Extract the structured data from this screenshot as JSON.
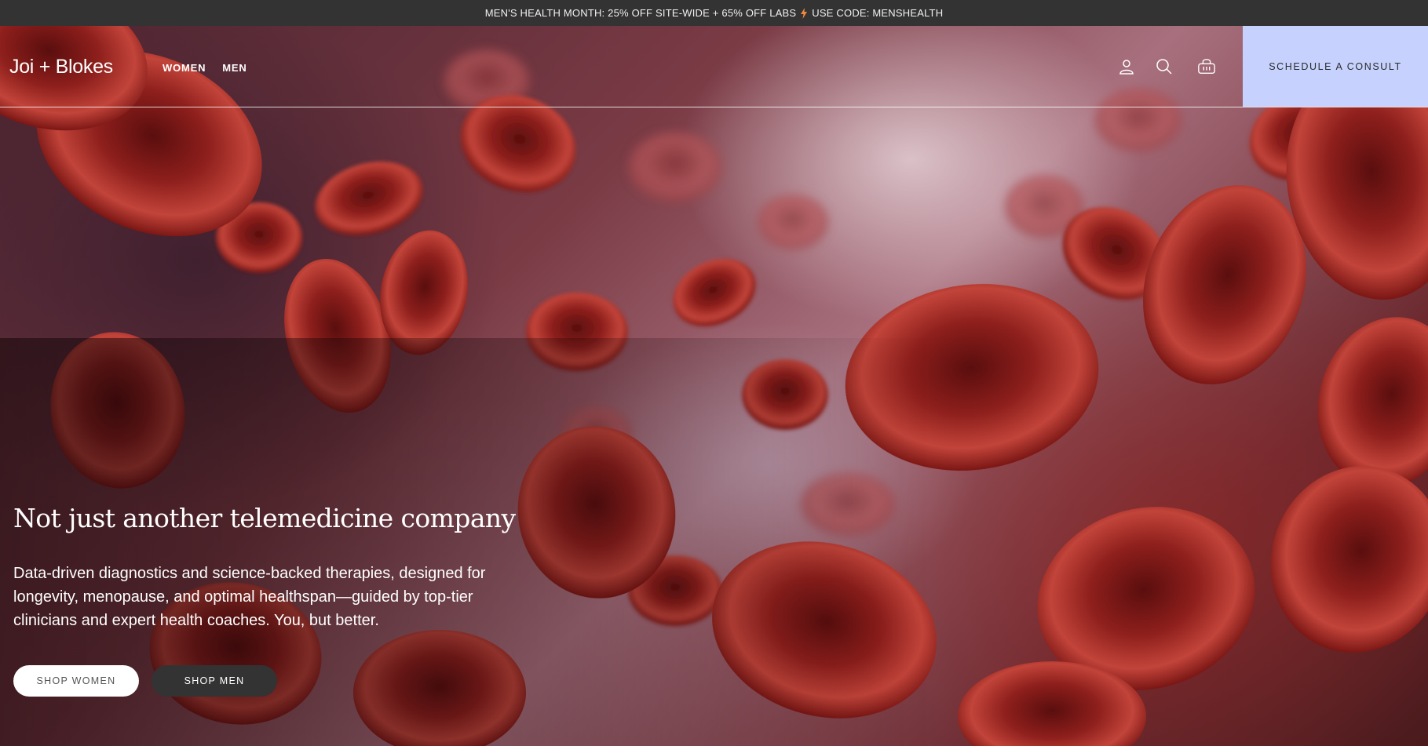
{
  "announcement": {
    "text_before": "MEN'S HEALTH MONTH: 25% OFF SITE-WIDE + 65% OFF LABS",
    "icon": "lightning-bolt-icon",
    "text_after": "USE CODE: MENSHEALTH"
  },
  "header": {
    "logo": "Joi + Blokes",
    "nav": [
      {
        "label": "WOMEN"
      },
      {
        "label": "MEN"
      }
    ],
    "icons": [
      "account-icon",
      "search-icon",
      "cart-icon"
    ],
    "cta": "SCHEDULE A CONSULT"
  },
  "hero": {
    "headline": "Not just another telemedicine company",
    "subcopy": "Data-driven diagnostics and science-backed therapies, designed for longevity, menopause, and optimal healthspan—guided by top-tier clinicians and expert health coaches. You, but better.",
    "buttons": [
      {
        "label": "SHOP WOMEN"
      },
      {
        "label": "SHOP MEN"
      }
    ]
  },
  "colors": {
    "announcement_bg": "#333333",
    "cta_bg": "#c6d2fd",
    "bolt": "#f0893c",
    "cell": "#b8322c"
  }
}
